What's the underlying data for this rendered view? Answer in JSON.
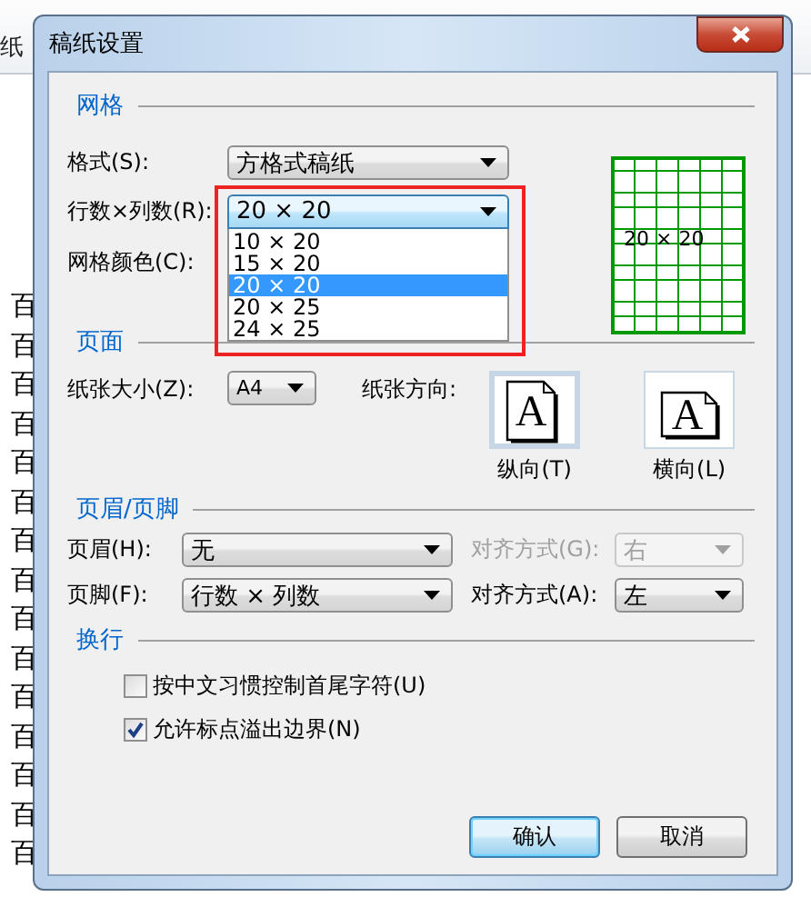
{
  "document": {
    "ribbon": [
      "纸"
    ],
    "lines": [
      "百",
      "百",
      "百",
      "百",
      "百",
      "百",
      "百",
      "百",
      "百",
      "百",
      "百",
      "百",
      "百",
      "百",
      "百"
    ]
  },
  "dialog": {
    "title": "稿纸设置",
    "grid": {
      "heading": "网格",
      "fields": [
        {
          "label": "格式(S):",
          "value": "方格式稿纸",
          "focused": false
        },
        {
          "label": "行数×列数(R):",
          "value": "20 × 20",
          "focused": true,
          "expanded": true,
          "options": [
            {
              "label": "10 × 20",
              "selected": false
            },
            {
              "label": "15 × 20",
              "selected": false
            },
            {
              "label": "20 × 20",
              "selected": true
            },
            {
              "label": "20 × 25",
              "selected": false
            },
            {
              "label": "24 × 25",
              "selected": false
            }
          ]
        },
        {
          "label": "网格颜色(C):"
        }
      ],
      "preview_label": "20 × 20"
    },
    "page": {
      "heading": "页面",
      "size_label": "纸张大小(Z):",
      "size_value": "A4",
      "orientation_label": "纸张方向:",
      "orientations": [
        {
          "kind": "portrait",
          "letter": "A",
          "label": "纵向(T)",
          "selected": true
        },
        {
          "kind": "landscape",
          "letter": "A",
          "label": "横向(L)",
          "selected": false
        }
      ]
    },
    "header_footer": {
      "heading": "页眉/页脚",
      "rows": [
        {
          "label": "页眉(H):",
          "value": "无",
          "align_label": "对齐方式(G):",
          "align_value": "右",
          "align_disabled": true
        },
        {
          "label": "页脚(F):",
          "value": "行数 × 列数",
          "align_label": "对齐方式(A):",
          "align_value": "左",
          "align_disabled": false
        }
      ]
    },
    "wrap": {
      "heading": "换行",
      "checkboxes": [
        {
          "label": "按中文习惯控制首尾字符(U)",
          "checked": false
        },
        {
          "label": "允许标点溢出边界(N)",
          "checked": true
        }
      ]
    },
    "buttons": [
      {
        "label": "确认",
        "default": true
      },
      {
        "label": "取消",
        "default": false
      }
    ]
  }
}
